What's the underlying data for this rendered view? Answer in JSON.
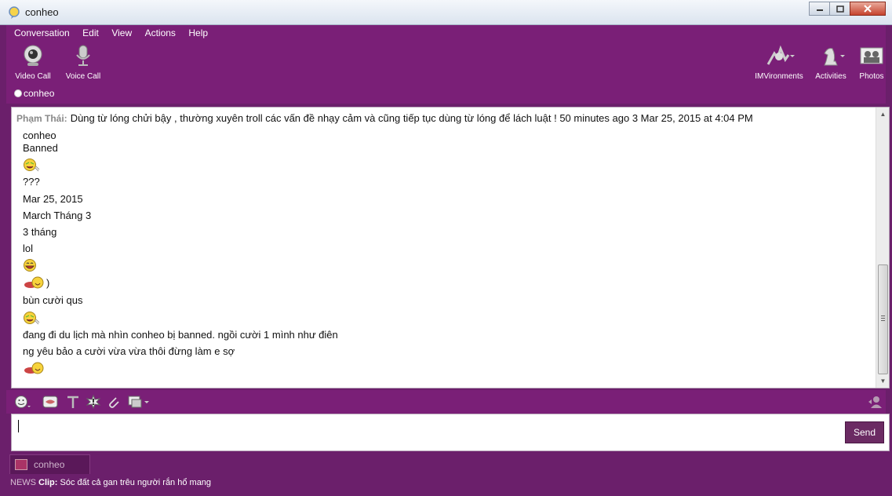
{
  "window": {
    "title": "conheo"
  },
  "menu": [
    "Conversation",
    "Edit",
    "View",
    "Actions",
    "Help"
  ],
  "toolbar": {
    "video_call": "Video Call",
    "voice_call": "Voice Call",
    "imvironments": "IMVironments",
    "activities": "Activities",
    "photos": "Photos"
  },
  "contact": {
    "name": "conheo"
  },
  "conversation": {
    "sender": "Phạm Thái:",
    "first_message": "Dùng từ lóng chửi bậy , thường xuyên troll các vấn đề nhạy cảm và cũng tiếp tục dùng từ lóng để lách luật ! 50 minutes ago 3 Mar 25, 2015 at 4:04 PM",
    "lines": [
      "conheo",
      "Banned",
      "???",
      "Mar 25, 2015",
      "March Tháng 3",
      "3 tháng",
      "lol",
      ")",
      "bùn cười qus",
      "đang đi du lịch  mà nhìn conheo bị banned. ngồi cười 1 mình như điên",
      "ng yêu bảo a cười vừa vừa thôi đừng làm e sợ"
    ]
  },
  "input": {
    "send_label": "Send"
  },
  "tabs": [
    {
      "label": "conheo"
    }
  ],
  "news": {
    "label": "NEWS",
    "clip_label": "Clip:",
    "clip_text": "Sóc đất cả gan trêu người rắn hổ mang"
  }
}
